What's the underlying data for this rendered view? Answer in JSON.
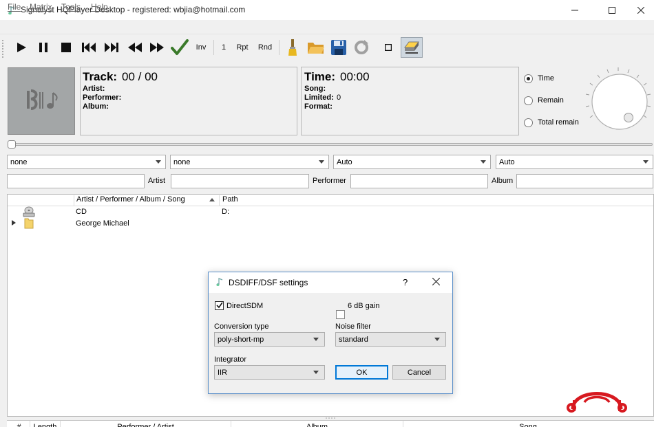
{
  "window": {
    "title": "Signalyst HQPlayer Desktop - registered: wbjia@hotmail.com"
  },
  "menu": [
    "File",
    "Matrix",
    "Tools",
    "Help"
  ],
  "toolbar": {
    "inv": "Inv",
    "one": "1",
    "rpt": "Rpt",
    "rnd": "Rnd"
  },
  "track_panel": {
    "track_label": "Track:",
    "track_value": "00 / 00",
    "artist": "Artist:",
    "performer": "Performer:",
    "album": "Album:"
  },
  "time_panel": {
    "time_label": "Time:",
    "time_value": "00:00",
    "song": "Song:",
    "limited_label": "Limited:",
    "limited_value": "0",
    "format": "Format:"
  },
  "display_mode": {
    "options": [
      "Time",
      "Remain",
      "Total remain"
    ],
    "selected": "Time"
  },
  "selectors": [
    "none",
    "none",
    "Auto",
    "Auto"
  ],
  "filters": {
    "artist_label": "Artist",
    "performer_label": "Performer",
    "album_label": "Album"
  },
  "library": {
    "columns": [
      "Artist / Performer / Album / Song",
      "Path"
    ],
    "rows": [
      {
        "name": "CD",
        "path": "D:",
        "icon": "cd-drive-icon"
      },
      {
        "name": "George Michael",
        "path": "",
        "icon": "folder-icon"
      }
    ]
  },
  "playlist": {
    "columns": [
      "#",
      "Length",
      "Performer / Artist",
      "Album",
      "Song"
    ]
  },
  "dialog": {
    "title": "DSDIFF/DSF settings",
    "help": "?",
    "directsdm_label": "DirectSDM",
    "directsdm_checked": true,
    "gain_label": "6 dB gain",
    "gain_checked": false,
    "conversion_label": "Conversion type",
    "conversion_value": "poly-short-mp",
    "noise_label": "Noise filter",
    "noise_value": "standard",
    "integrator_label": "Integrator",
    "integrator_value": "IIR",
    "ok": "OK",
    "cancel": "Cancel"
  },
  "colors": {
    "accent": "#0078d7",
    "watermark": "#d71920"
  }
}
